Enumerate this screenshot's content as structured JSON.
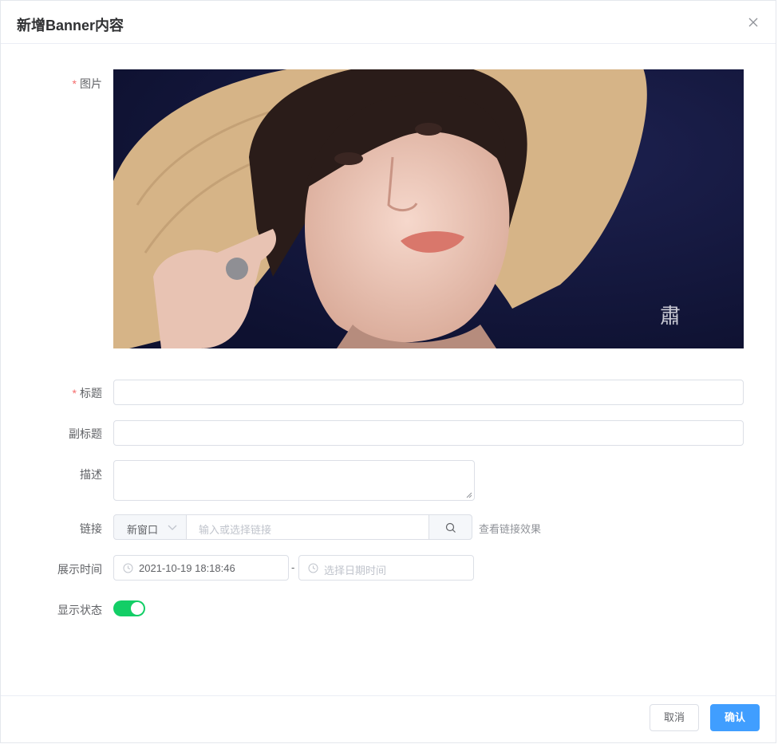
{
  "dialog": {
    "title": "新增Banner内容",
    "close_icon": "close-icon"
  },
  "form": {
    "image": {
      "required_mark": "*",
      "label": "图片"
    },
    "title": {
      "required_mark": "*",
      "label": "标题",
      "value": ""
    },
    "subtitle": {
      "label": "副标题",
      "value": ""
    },
    "description": {
      "label": "描述",
      "value": ""
    },
    "link": {
      "label": "链接",
      "target_option": "新窗口",
      "placeholder": "输入或选择链接",
      "search_icon": "search-icon",
      "preview_text": "查看链接效果"
    },
    "display_time": {
      "label": "展示时间",
      "start_value": "2021-10-19 18:18:46",
      "separator": "-",
      "end_placeholder": "选择日期时间",
      "clock_icon": "clock-icon"
    },
    "status": {
      "label": "显示状态",
      "enabled": true
    }
  },
  "footer": {
    "cancel_label": "取消",
    "confirm_label": "确认"
  },
  "colors": {
    "primary": "#409eff",
    "switch_on": "#13ce66",
    "required": "#f56c6c"
  }
}
